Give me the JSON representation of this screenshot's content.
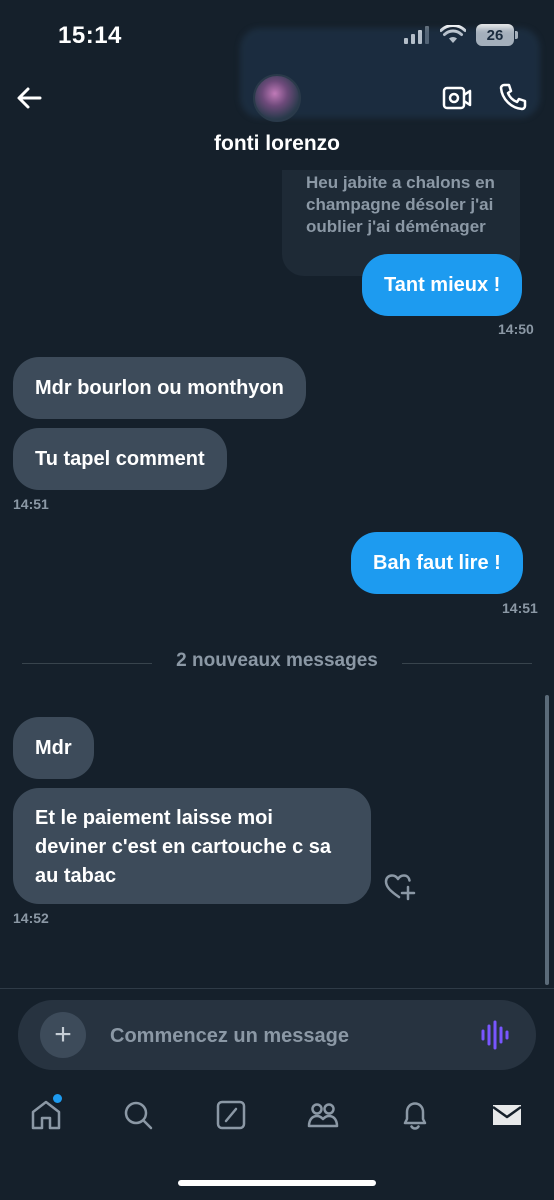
{
  "status_bar": {
    "time": "15:14",
    "battery": "26"
  },
  "header": {
    "contact_name": "fonti lorenzo"
  },
  "messages": {
    "quoted_text": "Heu jabite a chalons en champagne désoler j'ai oublier j'ai déménager",
    "m1": "Tant mieux !",
    "t1": "14:50",
    "m2": "Mdr bourlon ou monthyon",
    "m3": "Tu tapel comment",
    "t2": "14:51",
    "m4": "Bah faut lire !",
    "t3": "14:51",
    "divider": "2 nouveaux messages",
    "m5": "Mdr",
    "m6": "Et le paiement laisse moi deviner c'est en cartouche c sa au tabac",
    "t4": "14:52"
  },
  "composer": {
    "placeholder": "Commencez un message"
  },
  "colors": {
    "background": "#15202b",
    "outgoing_bubble": "#1d9bf0",
    "incoming_bubble": "#3d4b5a",
    "accent_voice": "#7856ff"
  },
  "icons": {
    "back": "arrow-left-icon",
    "video": "video-camera-icon",
    "phone": "phone-icon",
    "add_reaction": "heart-plus-icon",
    "plus": "plus-icon",
    "voice": "voice-wave-icon",
    "tabs": [
      "home-icon",
      "search-icon",
      "compose-icon",
      "communities-icon",
      "bell-icon",
      "mail-icon"
    ]
  }
}
